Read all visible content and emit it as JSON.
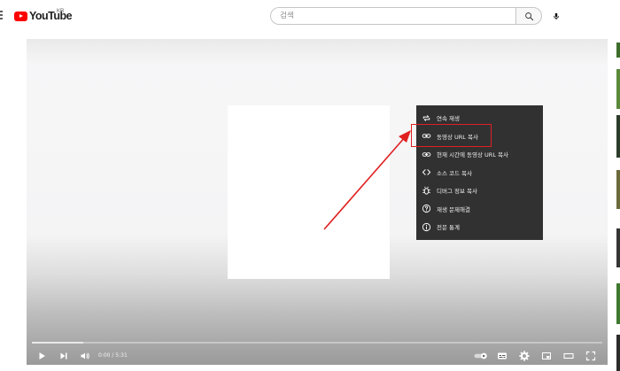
{
  "header": {
    "logo_text": "YouTube",
    "region": "KR",
    "search_placeholder": "검색"
  },
  "context_menu": {
    "items": [
      {
        "icon": "loop-icon",
        "label": "연속 재생"
      },
      {
        "icon": "link-icon",
        "label": "동영상 URL 복사"
      },
      {
        "icon": "link-icon",
        "label": "현재 시간에 동영상 URL 복사"
      },
      {
        "icon": "code-icon",
        "label": "소스 코드 복사"
      },
      {
        "icon": "bug-icon",
        "label": "디버그 정보 복사"
      },
      {
        "icon": "help-icon",
        "label": "재생 문제해결"
      },
      {
        "icon": "info-icon",
        "label": "전문 통계"
      }
    ],
    "highlighted_index": 1
  },
  "player": {
    "time_display": "0:00 / 5:31",
    "loaded_fraction": 0.09
  },
  "colors": {
    "brand_red": "#ff0000",
    "annotation_red": "#e02020"
  }
}
